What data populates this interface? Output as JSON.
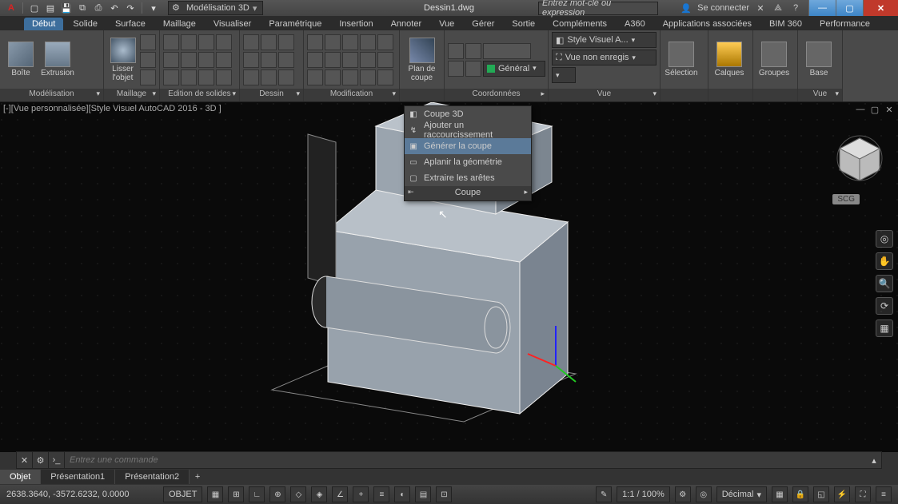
{
  "title": {
    "doc": "Dessin1.dwg",
    "search_placeholder": "Entrez mot-clé ou expression",
    "signin": "Se connecter",
    "workspace": "Modélisation 3D"
  },
  "tabs": [
    "Début",
    "Solide",
    "Surface",
    "Maillage",
    "Visualiser",
    "Paramétrique",
    "Insertion",
    "Annoter",
    "Vue",
    "Gérer",
    "Sortie",
    "Compléments",
    "A360",
    "Applications associées",
    "BIM 360",
    "Performance"
  ],
  "panels": {
    "modelisation": {
      "title": "Modélisation",
      "btn1": "Boîte",
      "btn2": "Extrusion",
      "btn3": "Lisser l'objet"
    },
    "maillage": {
      "title": "Maillage"
    },
    "edition": {
      "title": "Edition de solides"
    },
    "dessin": {
      "title": "Dessin"
    },
    "modification": {
      "title": "Modification"
    },
    "coupe": {
      "title": "",
      "btn": "Plan de coupe"
    },
    "coord": {
      "title": "Coordonnées"
    },
    "vue1": {
      "title": "Vue",
      "style": "Style Visuel A...",
      "saved": "Vue non enregis"
    },
    "calques": {
      "title": "",
      "general": "Général"
    },
    "sel": {
      "title": "",
      "btn1": "Sélection",
      "btn2": "Calques",
      "btn3": "Groupes",
      "btn4": "Base"
    },
    "vue2": {
      "title": "Vue"
    }
  },
  "ctx": {
    "items": [
      "Coupe 3D",
      "Ajouter un raccourcissement",
      "Générer la coupe",
      "Aplanir la géométrie",
      "Extraire les arêtes"
    ],
    "footer": "Coupe"
  },
  "viewport": {
    "label": "[-][Vue personnalisée][Style Visuel AutoCAD 2016 - 3D ]",
    "wcs": "SCG"
  },
  "cmd": {
    "placeholder": "Entrez une commande"
  },
  "layouts": [
    "Objet",
    "Présentation1",
    "Présentation2"
  ],
  "status": {
    "coords": "2638.3640, -3572.6232, 0.0000",
    "mode": "OBJET",
    "scale": "1:1 / 100%",
    "units": "Décimal"
  }
}
